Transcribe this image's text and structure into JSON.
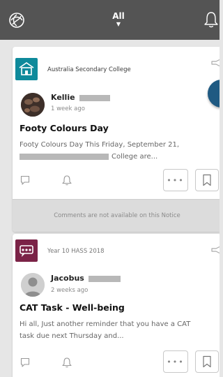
{
  "header": {
    "filter_label": "All",
    "caret": "▼"
  },
  "icons": {
    "logo": "logo-icon",
    "bell": "bell-icon",
    "megaphone": "megaphone-icon",
    "comment": "comment-icon",
    "bookmark": "bookmark-icon",
    "more": "more-icon"
  },
  "colors": {
    "topbar": "#545454",
    "school_group": "#0e8a9b",
    "class_group": "#7b2347",
    "fab": "#1f5a82"
  },
  "notices": [
    {
      "group": "Australia Secondary College",
      "author": "Kellie",
      "time": "1 week ago",
      "title": "Footy Colours Day",
      "excerpt_line1": "Footy Colours Day This Friday, September 21,",
      "excerpt_line2": "College are...",
      "more_label": "•••",
      "comments_note": "Comments are not available on this Notice"
    },
    {
      "group": "Year 10 HASS 2018",
      "author": "Jacobus",
      "time": "2 weeks ago",
      "title": "CAT Task - Well-being",
      "excerpt_line1": "Hi all, Just another reminder that you have a CAT",
      "excerpt_line2": "task due next Thursday and...",
      "more_label": "•••"
    }
  ]
}
